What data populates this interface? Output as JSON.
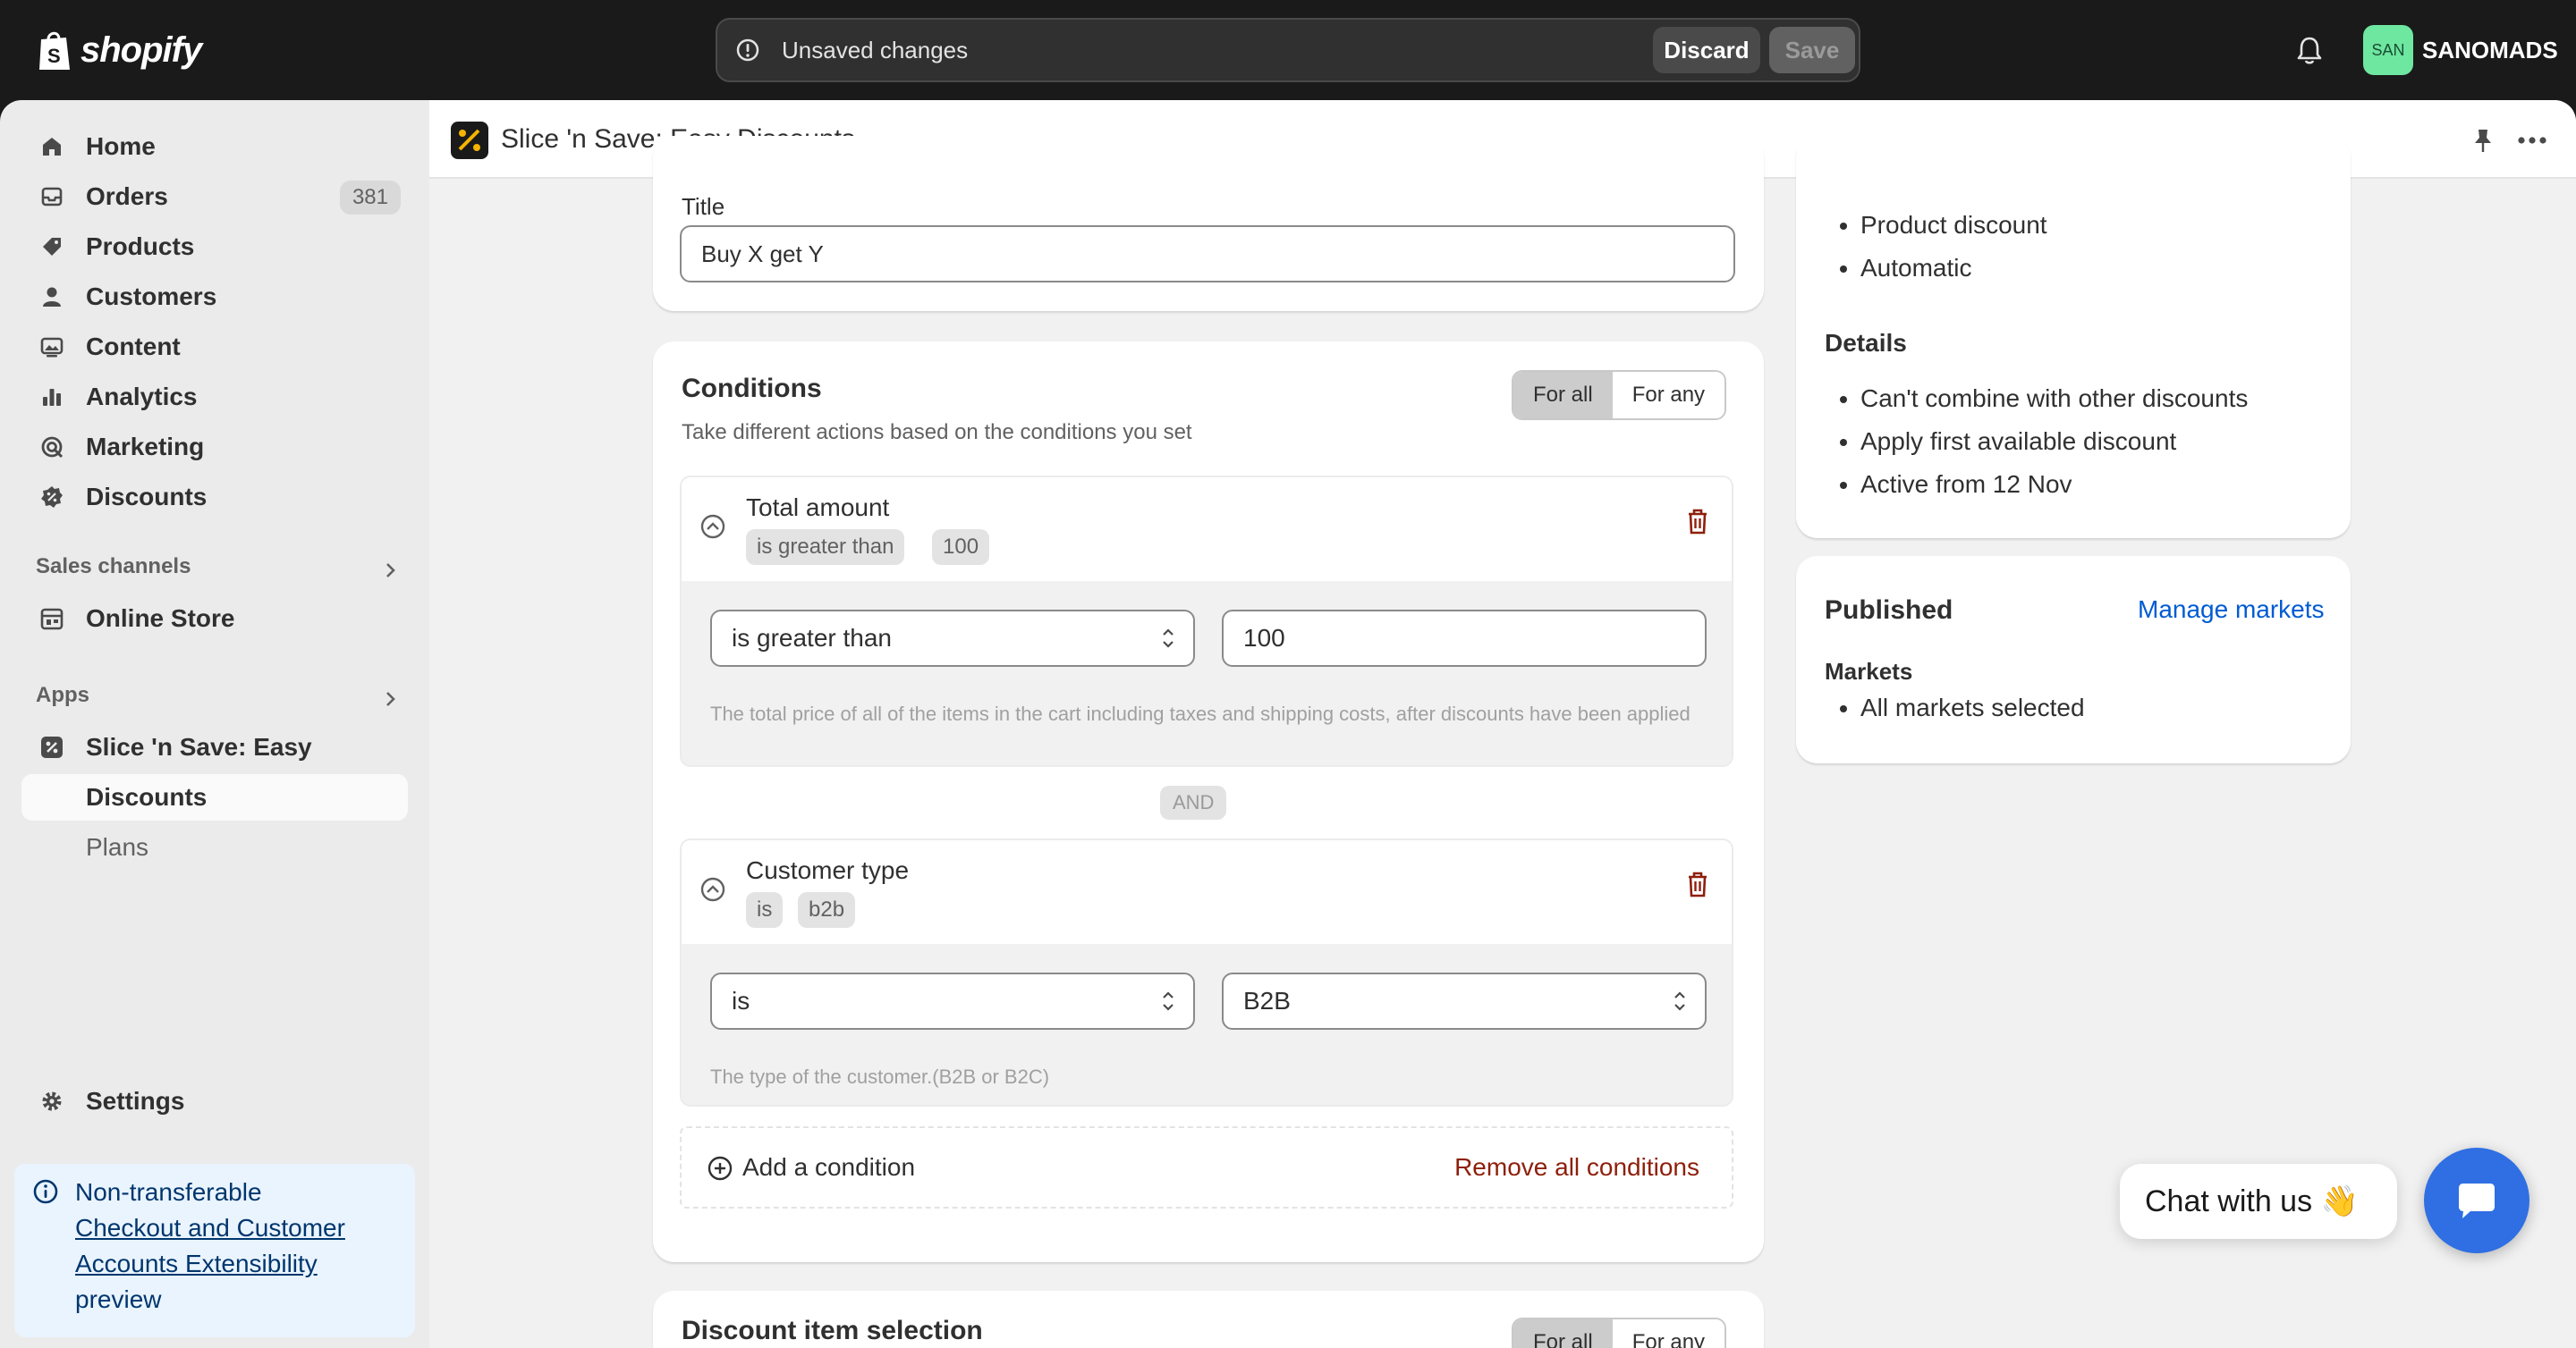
{
  "topbar": {
    "brand": "shopify",
    "unsaved_message": "Unsaved changes",
    "discard_label": "Discard",
    "save_label": "Save",
    "avatar_initials": "SAN",
    "store_name": "SANOMADS"
  },
  "sidebar": {
    "items": [
      {
        "label": "Home",
        "icon": "home-icon"
      },
      {
        "label": "Orders",
        "icon": "inbox-icon",
        "badge": "381"
      },
      {
        "label": "Products",
        "icon": "tag-icon"
      },
      {
        "label": "Customers",
        "icon": "person-icon"
      },
      {
        "label": "Content",
        "icon": "image-icon"
      },
      {
        "label": "Analytics",
        "icon": "bar-chart-icon"
      },
      {
        "label": "Marketing",
        "icon": "target-icon"
      },
      {
        "label": "Discounts",
        "icon": "discount-icon"
      }
    ],
    "sales_channels_label": "Sales channels",
    "online_store_label": "Online Store",
    "apps_label": "Apps",
    "app_name": "Slice 'n Save: Easy Discou...",
    "app_sub_items": [
      {
        "label": "Discounts",
        "selected": true
      },
      {
        "label": "Plans",
        "selected": false
      }
    ],
    "settings_label": "Settings",
    "notice": {
      "line1": "Non-transferable",
      "link": "Checkout and Customer Accounts Extensibility",
      "line3": "preview"
    }
  },
  "app_header": {
    "title": "Slice 'n Save: Easy Discounts"
  },
  "title_card": {
    "label": "Title",
    "value": "Buy X get Y"
  },
  "conditions_card": {
    "title": "Conditions",
    "subtitle": "Take different actions based on the conditions you set",
    "toggle": {
      "for_all": "For all",
      "for_any": "For any",
      "selected": "For all"
    },
    "conditions": [
      {
        "name": "Total amount",
        "tags": [
          "is greater than",
          "100"
        ],
        "operator": "is greater than",
        "value": "100",
        "help": "The total price of all of the items in the cart including taxes and shipping costs, after discounts have been applied"
      },
      {
        "name": "Customer type",
        "tags": [
          "is",
          "b2b"
        ],
        "operator": "is",
        "value": "B2B",
        "help": "The type of the customer.(B2B or B2C)"
      }
    ],
    "joiner": "AND",
    "add_condition_label": "Add a condition",
    "remove_all_label": "Remove all conditions"
  },
  "discount_item_card": {
    "title": "Discount item selection",
    "toggle": {
      "for_all": "For all",
      "for_any": "For any"
    }
  },
  "summary_card": {
    "types": [
      "Product discount",
      "Automatic"
    ],
    "details_title": "Details",
    "details": [
      "Can't combine with other discounts",
      "Apply first available discount",
      "Active from 12 Nov"
    ]
  },
  "published_card": {
    "title": "Published",
    "manage_link": "Manage markets",
    "markets_title": "Markets",
    "markets": [
      "All markets selected"
    ]
  },
  "chat": {
    "label": "Chat with us 👋"
  },
  "colors": {
    "topbar_bg": "#1a1a1a",
    "sidebar_bg": "#ebebeb",
    "main_bg": "#f1f1f1",
    "link_blue": "#005bd3",
    "critical_red": "#8e1f0b",
    "chat_blue": "#2f6fe3",
    "avatar_green": "#6ee7a0"
  }
}
